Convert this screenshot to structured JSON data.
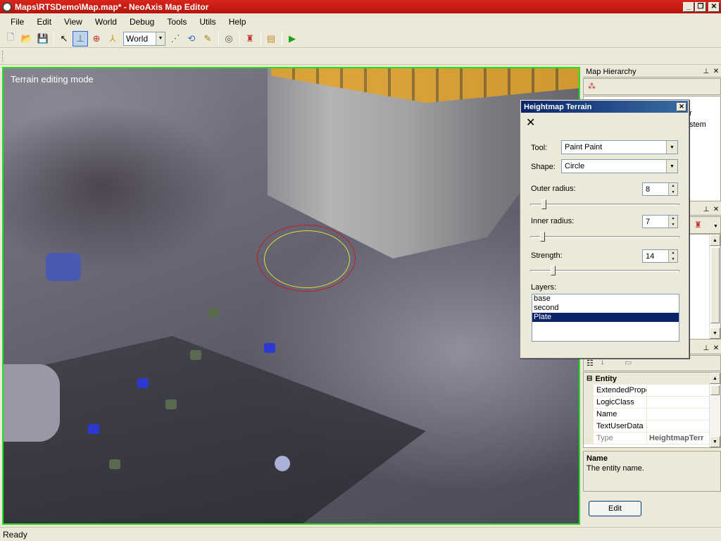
{
  "window": {
    "title": "Maps\\RTSDemo\\Map.map* - NeoAxis Map Editor"
  },
  "menu": [
    "File",
    "Edit",
    "View",
    "World",
    "Debug",
    "Tools",
    "Utils",
    "Help"
  ],
  "toolbar": {
    "coord_space": "World"
  },
  "viewport": {
    "mode_label": "Terrain editing mode"
  },
  "map_hierarchy": {
    "title": "Map Hierarchy",
    "partial_items": [
      "r",
      "stem"
    ]
  },
  "heightmap_dialog": {
    "title": "Heightmap Terrain",
    "tool_label": "Tool:",
    "tool_value": "Paint Paint",
    "shape_label": "Shape:",
    "shape_value": "Circle",
    "outer_radius_label": "Outer radius:",
    "outer_radius_value": "8",
    "inner_radius_label": "Inner radius:",
    "inner_radius_value": "7",
    "strength_label": "Strength:",
    "strength_value": "14",
    "outer_radius_fraction": 0.08,
    "inner_radius_fraction": 0.07,
    "strength_fraction": 0.14,
    "layers_label": "Layers:",
    "layers": [
      "base",
      "second",
      "Plate"
    ],
    "selected_layer": "Plate"
  },
  "properties": {
    "category": "Entity",
    "rows": [
      {
        "name": "ExtendedPrope",
        "value": ""
      },
      {
        "name": "LogicClass",
        "value": ""
      },
      {
        "name": "Name",
        "value": ""
      },
      {
        "name": "TextUserData",
        "value": ""
      },
      {
        "name": "Type",
        "value": "HeightmapTerr"
      }
    ]
  },
  "description": {
    "title": "Name",
    "text": "The entity name."
  },
  "edit_button": "Edit",
  "status": "Ready",
  "colors": {
    "title_bar": "#c41a12",
    "viewport_border": "#22e022",
    "selection": "#0a246a"
  }
}
